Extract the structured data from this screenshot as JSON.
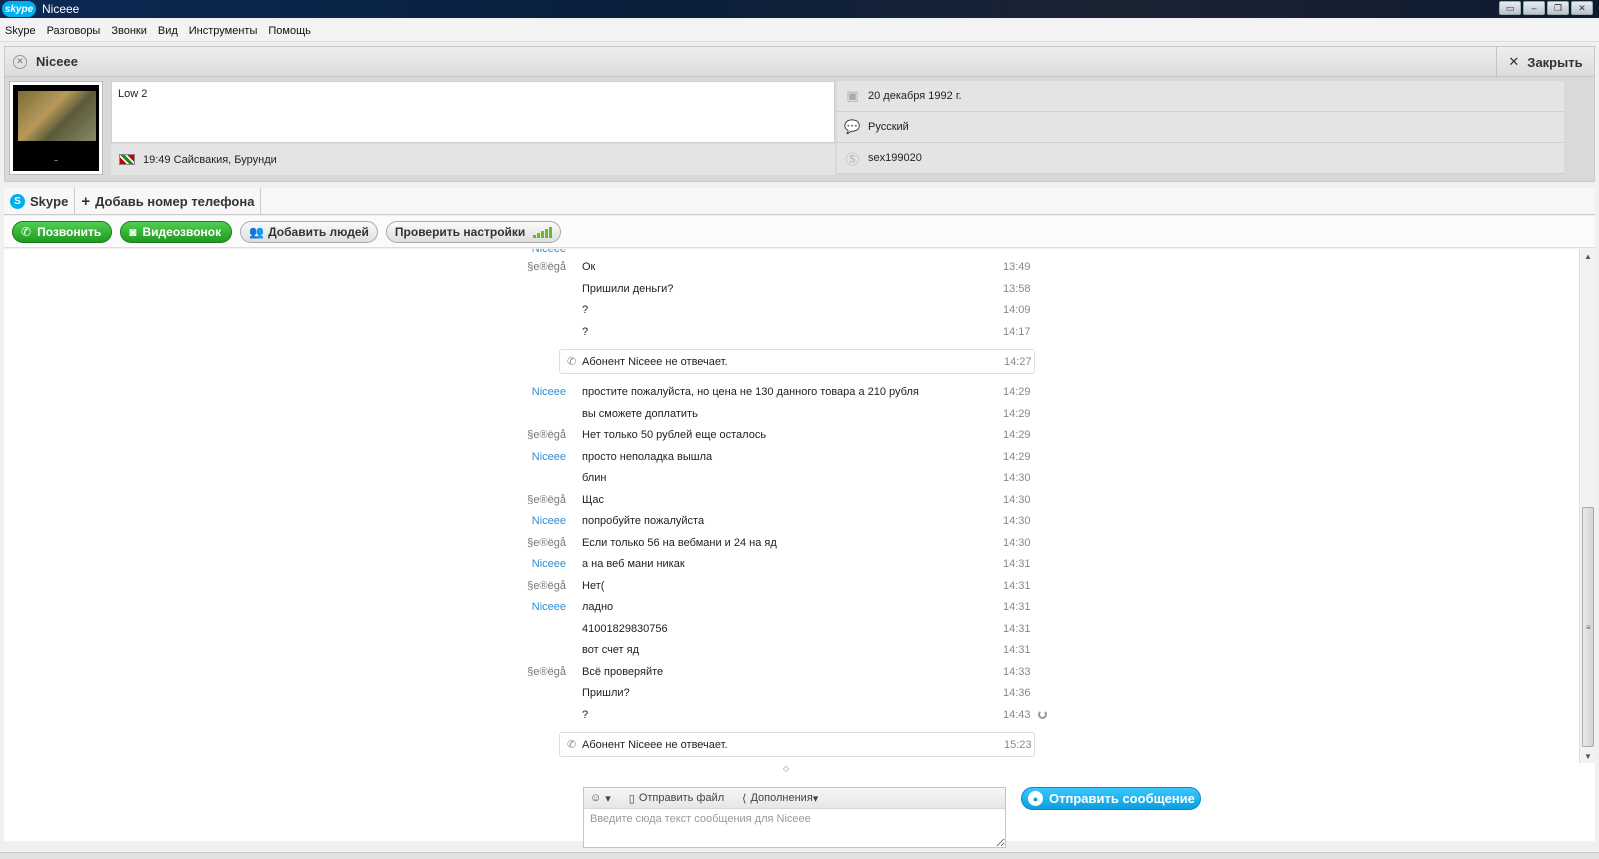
{
  "window": {
    "title": "Niceee",
    "logo": "skype"
  },
  "menu": [
    "Skype",
    "Разговоры",
    "Звонки",
    "Вид",
    "Инструменты",
    "Помощь"
  ],
  "contact": {
    "name": "Niceee",
    "close_label": "Закрыть",
    "mood": "Low 2",
    "local_time_location": "19:49 Сайсвакия, Бурунди",
    "birthday": "20 декабря 1992 г.",
    "language": "Русский",
    "skype_id": "sex199020"
  },
  "tabs": {
    "skype": "Skype",
    "add_phone": "Добавь номер телефона"
  },
  "actions": {
    "call": "Позвонить",
    "video": "Видеозвонок",
    "add_people": "Добавить людей",
    "check_settings": "Проверить настройки"
  },
  "messages": [
    {
      "sender": "§e®ëgå",
      "sender_style": "gray",
      "text": "Ок",
      "time": "13:49"
    },
    {
      "sender": "",
      "sender_style": "gray",
      "text": "Пришили деньги?",
      "time": "13:58"
    },
    {
      "sender": "",
      "sender_style": "gray",
      "text": "?",
      "time": "14:09"
    },
    {
      "sender": "",
      "sender_style": "gray",
      "text": "?",
      "time": "14:17"
    },
    {
      "system": true,
      "text": "Абонент Niceee не отвечает.",
      "time": "14:27"
    },
    {
      "sender": "Niceee",
      "sender_style": "blue",
      "text": "простите пожалуйста, но цена не 130 данного товара а 210 рубля",
      "time": "14:29"
    },
    {
      "sender": "",
      "sender_style": "blue",
      "text": "вы сможете доплатить",
      "time": "14:29"
    },
    {
      "sender": "§e®ëgå",
      "sender_style": "gray",
      "text": "Нет только 50 рублей еще осталось",
      "time": "14:29"
    },
    {
      "sender": "Niceee",
      "sender_style": "blue",
      "text": "просто неполадка вышла",
      "time": "14:29"
    },
    {
      "sender": "",
      "sender_style": "blue",
      "text": "блин",
      "time": "14:30"
    },
    {
      "sender": "§e®ëgå",
      "sender_style": "gray",
      "text": "Щас",
      "time": "14:30"
    },
    {
      "sender": "Niceee",
      "sender_style": "blue",
      "text": "попробуйте пожалуйста",
      "time": "14:30"
    },
    {
      "sender": "§e®ëgå",
      "sender_style": "gray",
      "text": "Если только 56 на вебмани и 24 на яд",
      "time": "14:30"
    },
    {
      "sender": "Niceee",
      "sender_style": "blue",
      "text": "а на веб мани никак",
      "time": "14:31"
    },
    {
      "sender": "§e®ëgå",
      "sender_style": "gray",
      "text": "Нет(",
      "time": "14:31"
    },
    {
      "sender": "Niceee",
      "sender_style": "blue",
      "text": "ладно",
      "time": "14:31"
    },
    {
      "sender": "",
      "sender_style": "blue",
      "text": "41001829830756",
      "time": "14:31"
    },
    {
      "sender": "",
      "sender_style": "blue",
      "text": "вот счет яд",
      "time": "14:31"
    },
    {
      "sender": "§e®ëgå",
      "sender_style": "gray",
      "text": "Всё проверяйте",
      "time": "14:33"
    },
    {
      "sender": "",
      "sender_style": "gray",
      "text": "Пришли?",
      "time": "14:36"
    },
    {
      "sender": "",
      "sender_style": "gray",
      "text": "?",
      "time": "14:43",
      "pending": true
    },
    {
      "system": true,
      "text": "Абонент Niceee не отвечает.",
      "time": "15:23"
    }
  ],
  "composer": {
    "send_file": "Отправить файл",
    "extras": "Дополнения",
    "placeholder": "Введите сюда текст сообщения для Niceee",
    "send_label": "Отправить сообщение"
  },
  "colors": {
    "skype_blue": "#00aff0",
    "call_green": "#2fb52f",
    "sender_blue": "#2b8fd8"
  }
}
